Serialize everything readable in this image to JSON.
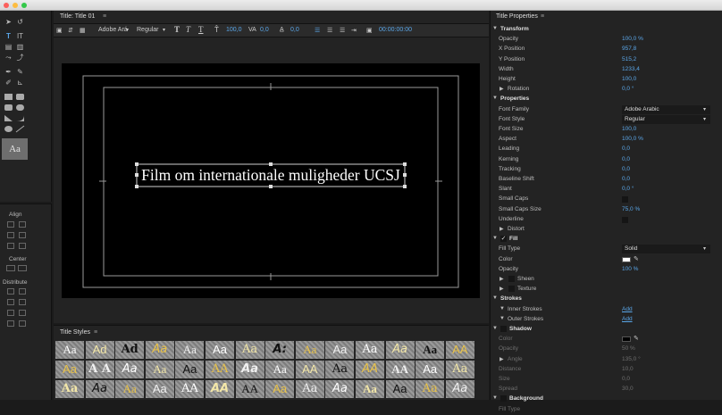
{
  "panels": {
    "title_panel": "Title: Title 01",
    "styles_panel": "Title Styles",
    "properties_panel": "Title Properties",
    "actions": {
      "align": "Align",
      "center": "Center",
      "distribute": "Distribute"
    }
  },
  "toolbar": {
    "font": "Adobe Ará",
    "style": "Regular",
    "size": "100,0",
    "kerning": "0,0",
    "leading": "0,0",
    "timecode": "00:00:00:00"
  },
  "canvas": {
    "text": "Film om internationale muligheder UCSJ"
  },
  "tools": {
    "preview": "Aa"
  },
  "styles": {
    "rows": [
      [
        "Aa",
        "Ad",
        "Ad",
        "Aa",
        "Aa",
        "Aa",
        "Aa",
        "A:",
        "Aa",
        "Aa",
        "Aa",
        "Aa",
        "Aa",
        "AA"
      ],
      [
        "Aa",
        "A A",
        "Aa",
        "Aa",
        "Aa",
        "AA",
        "Aa",
        "Aa",
        "AA",
        "Aa",
        "AA",
        "AA",
        "Aa",
        "Aa"
      ],
      [
        "Aa",
        "Aa",
        "Aa",
        "Aa",
        "AA",
        "AA",
        "AA",
        "Aa",
        "Aa",
        "Aa",
        "Aa",
        "Aa",
        "Aa",
        "Aa"
      ]
    ]
  },
  "properties": [
    {
      "type": "section",
      "label": "Transform",
      "open": true
    },
    {
      "type": "row",
      "label": "Opacity",
      "value": "100,0 %"
    },
    {
      "type": "row",
      "label": "X Position",
      "value": "957,8"
    },
    {
      "type": "row",
      "label": "Y Position",
      "value": "515,2"
    },
    {
      "type": "row",
      "label": "Width",
      "value": "1233,4"
    },
    {
      "type": "row",
      "label": "Height",
      "value": "100,0"
    },
    {
      "type": "sub",
      "label": "Rotation",
      "value": "0,0 °"
    },
    {
      "type": "section",
      "label": "Properties",
      "open": true
    },
    {
      "type": "dropdown",
      "label": "Font Family",
      "value": "Adobe Arabic"
    },
    {
      "type": "dropdown",
      "label": "Font Style",
      "value": "Regular"
    },
    {
      "type": "row",
      "label": "Font Size",
      "value": "100,0"
    },
    {
      "type": "row",
      "label": "Aspect",
      "value": "100,0 %"
    },
    {
      "type": "row",
      "label": "Leading",
      "value": "0,0"
    },
    {
      "type": "row",
      "label": "Kerning",
      "value": "0,0"
    },
    {
      "type": "row",
      "label": "Tracking",
      "value": "0,0"
    },
    {
      "type": "row",
      "label": "Baseline Shift",
      "value": "0,0"
    },
    {
      "type": "row",
      "label": "Slant",
      "value": "0,0 °"
    },
    {
      "type": "check",
      "label": "Small Caps",
      "value": ""
    },
    {
      "type": "row",
      "label": "Small Caps Size",
      "value": "75,0 %"
    },
    {
      "type": "check",
      "label": "Underline",
      "value": ""
    },
    {
      "type": "sub",
      "label": "Distort",
      "value": ""
    },
    {
      "type": "checksec",
      "label": "Fill",
      "value": ""
    },
    {
      "type": "dropdown",
      "label": "Fill Type",
      "value": "Solid"
    },
    {
      "type": "color",
      "label": "Color",
      "value": ""
    },
    {
      "type": "row",
      "label": "Opacity",
      "value": "100 %"
    },
    {
      "type": "subcheck",
      "label": "Sheen",
      "value": ""
    },
    {
      "type": "subcheck",
      "label": "Texture",
      "value": ""
    },
    {
      "type": "section",
      "label": "Strokes",
      "open": true
    },
    {
      "type": "link",
      "label": "Inner Strokes",
      "value": "Add"
    },
    {
      "type": "link",
      "label": "Outer Strokes",
      "value": "Add"
    },
    {
      "type": "checksec",
      "label": "Shadow",
      "value": ""
    },
    {
      "type": "dimcolor",
      "label": "Color",
      "value": ""
    },
    {
      "type": "dim",
      "label": "Opacity",
      "value": "50 %"
    },
    {
      "type": "dimsub",
      "label": "Angle",
      "value": "135,0 °"
    },
    {
      "type": "dim",
      "label": "Distance",
      "value": "10,0"
    },
    {
      "type": "dim",
      "label": "Size",
      "value": "0,0"
    },
    {
      "type": "dim",
      "label": "Spread",
      "value": "30,0"
    },
    {
      "type": "checksec",
      "label": "Background",
      "value": ""
    },
    {
      "type": "dim",
      "label": "Fill Type",
      "value": ""
    }
  ],
  "colors": {
    "accent": "#5aa6e8",
    "fill_color": "#ffffff",
    "shadow_color": "#000000"
  }
}
